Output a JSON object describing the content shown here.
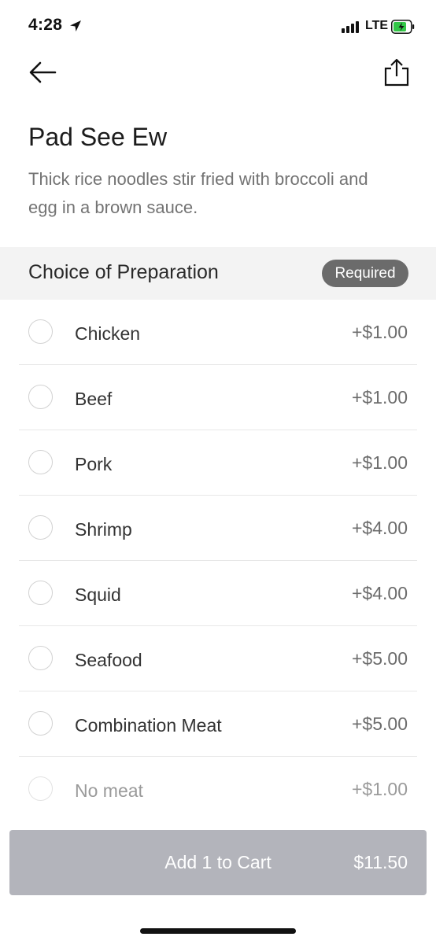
{
  "status_bar": {
    "time": "4:28",
    "network": "LTE",
    "battery_color": "#33c748"
  },
  "nav": {
    "back_icon": "arrow-left-icon",
    "share_icon": "share-icon"
  },
  "item": {
    "title": "Pad See Ew",
    "description": "Thick rice noodles stir fried with broccoli and egg in a brown sauce."
  },
  "section": {
    "title": "Choice of Preparation",
    "badge": "Required"
  },
  "options": [
    {
      "label": "Chicken",
      "price": "+$1.00"
    },
    {
      "label": "Beef",
      "price": "+$1.00"
    },
    {
      "label": "Pork",
      "price": "+$1.00"
    },
    {
      "label": "Shrimp",
      "price": "+$4.00"
    },
    {
      "label": "Squid",
      "price": "+$4.00"
    },
    {
      "label": "Seafood",
      "price": "+$5.00"
    },
    {
      "label": "Combination Meat",
      "price": "+$5.00"
    },
    {
      "label": "No meat",
      "price": "+$1.00"
    }
  ],
  "cart": {
    "label": "Add 1 to Cart",
    "total": "$11.50"
  }
}
